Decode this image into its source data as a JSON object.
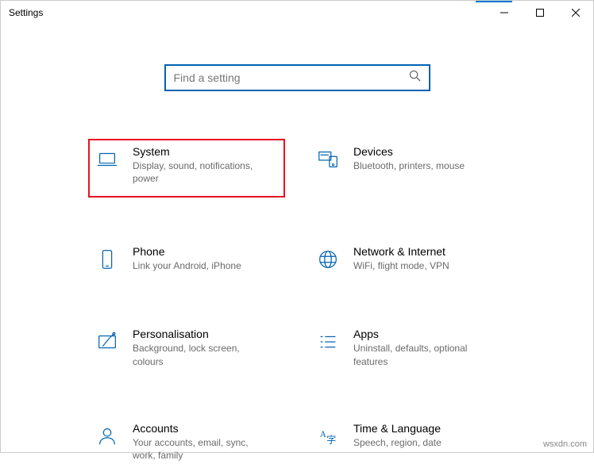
{
  "window": {
    "title": "Settings"
  },
  "search": {
    "placeholder": "Find a setting"
  },
  "tiles": {
    "system": {
      "title": "System",
      "sub": "Display, sound, notifications, power"
    },
    "devices": {
      "title": "Devices",
      "sub": "Bluetooth, printers, mouse"
    },
    "phone": {
      "title": "Phone",
      "sub": "Link your Android, iPhone"
    },
    "network": {
      "title": "Network & Internet",
      "sub": "WiFi, flight mode, VPN"
    },
    "personalisation": {
      "title": "Personalisation",
      "sub": "Background, lock screen, colours"
    },
    "apps": {
      "title": "Apps",
      "sub": "Uninstall, defaults, optional features"
    },
    "accounts": {
      "title": "Accounts",
      "sub": "Your accounts, email, sync, work, family"
    },
    "time": {
      "title": "Time & Language",
      "sub": "Speech, region, date"
    }
  },
  "watermark": "wsxdn.com"
}
